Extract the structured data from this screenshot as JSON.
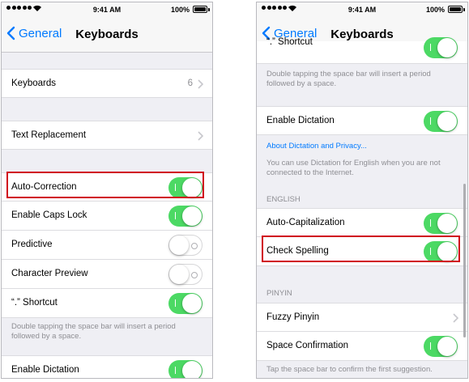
{
  "status_bar": {
    "time": "9:41 AM",
    "battery": "100%"
  },
  "left": {
    "back_label": "General",
    "title": "Keyboards",
    "keyboards_row": {
      "label": "Keyboards",
      "value": "6"
    },
    "text_replacement_label": "Text Replacement",
    "toggles": [
      {
        "label": "Auto-Correction",
        "on": true
      },
      {
        "label": "Enable Caps Lock",
        "on": true
      },
      {
        "label": "Predictive",
        "on": false
      },
      {
        "label": "Character Preview",
        "on": false
      },
      {
        "label": "“.” Shortcut",
        "on": true
      }
    ],
    "shortcut_footer": "Double tapping the space bar will insert a period followed by a space.",
    "dictation_label": "Enable Dictation",
    "dictation_on": true
  },
  "right": {
    "back_label": "General",
    "title": "Keyboards",
    "shortcut_label": "“.” Shortcut",
    "shortcut_on": true,
    "shortcut_footer": "Double tapping the space bar will insert a period followed by a space.",
    "dictation_label": "Enable Dictation",
    "dictation_on": true,
    "dictation_link": "About Dictation and Privacy...",
    "dictation_footer": "You can use Dictation for English when you are not connected to the Internet.",
    "english_header": "ENGLISH",
    "auto_cap_label": "Auto-Capitalization",
    "auto_cap_on": true,
    "check_spelling_label": "Check Spelling",
    "check_spelling_on": true,
    "pinyin_header": "PINYIN",
    "fuzzy_pinyin_label": "Fuzzy Pinyin",
    "space_confirm_label": "Space Confirmation",
    "space_confirm_on": true,
    "space_confirm_footer": "Tap the space bar to confirm the first suggestion."
  },
  "colors": {
    "accent": "#007aff",
    "toggle_on": "#4cd964",
    "highlight": "#d0021b"
  }
}
